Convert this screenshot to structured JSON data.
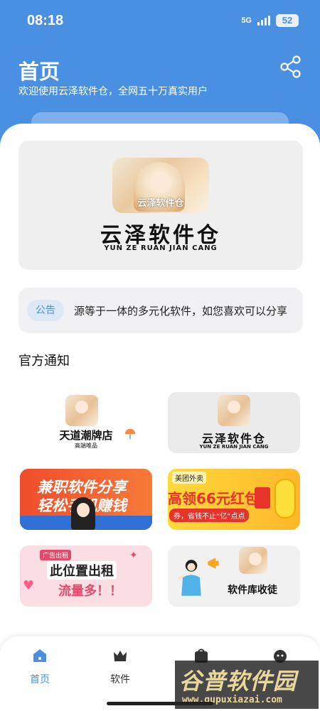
{
  "status_bar": {
    "time": "08:18",
    "network": "5G",
    "battery": "52"
  },
  "header": {
    "title": "首页",
    "subtitle": "欢迎使用云泽软件仓，全网五十万真实用户"
  },
  "banner": {
    "logo_caption": "云泽软件仓",
    "title": "云泽软件仓",
    "pinyin": "YUN ZE RUAN JIAN CANG"
  },
  "notice": {
    "tag": "公告",
    "text": "源等于一体的多元化软件，如您喜欢可以分享"
  },
  "section": {
    "title": "官方通知"
  },
  "tiles": [
    {
      "title": "天道潮牌店",
      "sub": "高端唯品"
    },
    {
      "title": "云泽软件仓",
      "sub": "YUN ZE RUAN JIAN CANG"
    },
    {
      "line1": "兼职软件分享",
      "line2": "轻松手机赚钱"
    },
    {
      "brand": "美团外卖",
      "headline": "高领66元红包",
      "tagline": "券，省钱不止“亿”点点"
    },
    {
      "badge": "广告出租",
      "line1": "此位置出租",
      "line2": "流量多！！"
    },
    {
      "title": "软件库收徒"
    }
  ],
  "nav": {
    "items": [
      {
        "label": "首页"
      },
      {
        "label": "软件"
      }
    ]
  },
  "watermark": {
    "title": "谷普软件园",
    "url": "www.gupuxiazai.com"
  },
  "colors": {
    "primary": "#4a90e2",
    "accent_orange": "#f04c2b",
    "accent_yellow": "#ffd93a"
  }
}
